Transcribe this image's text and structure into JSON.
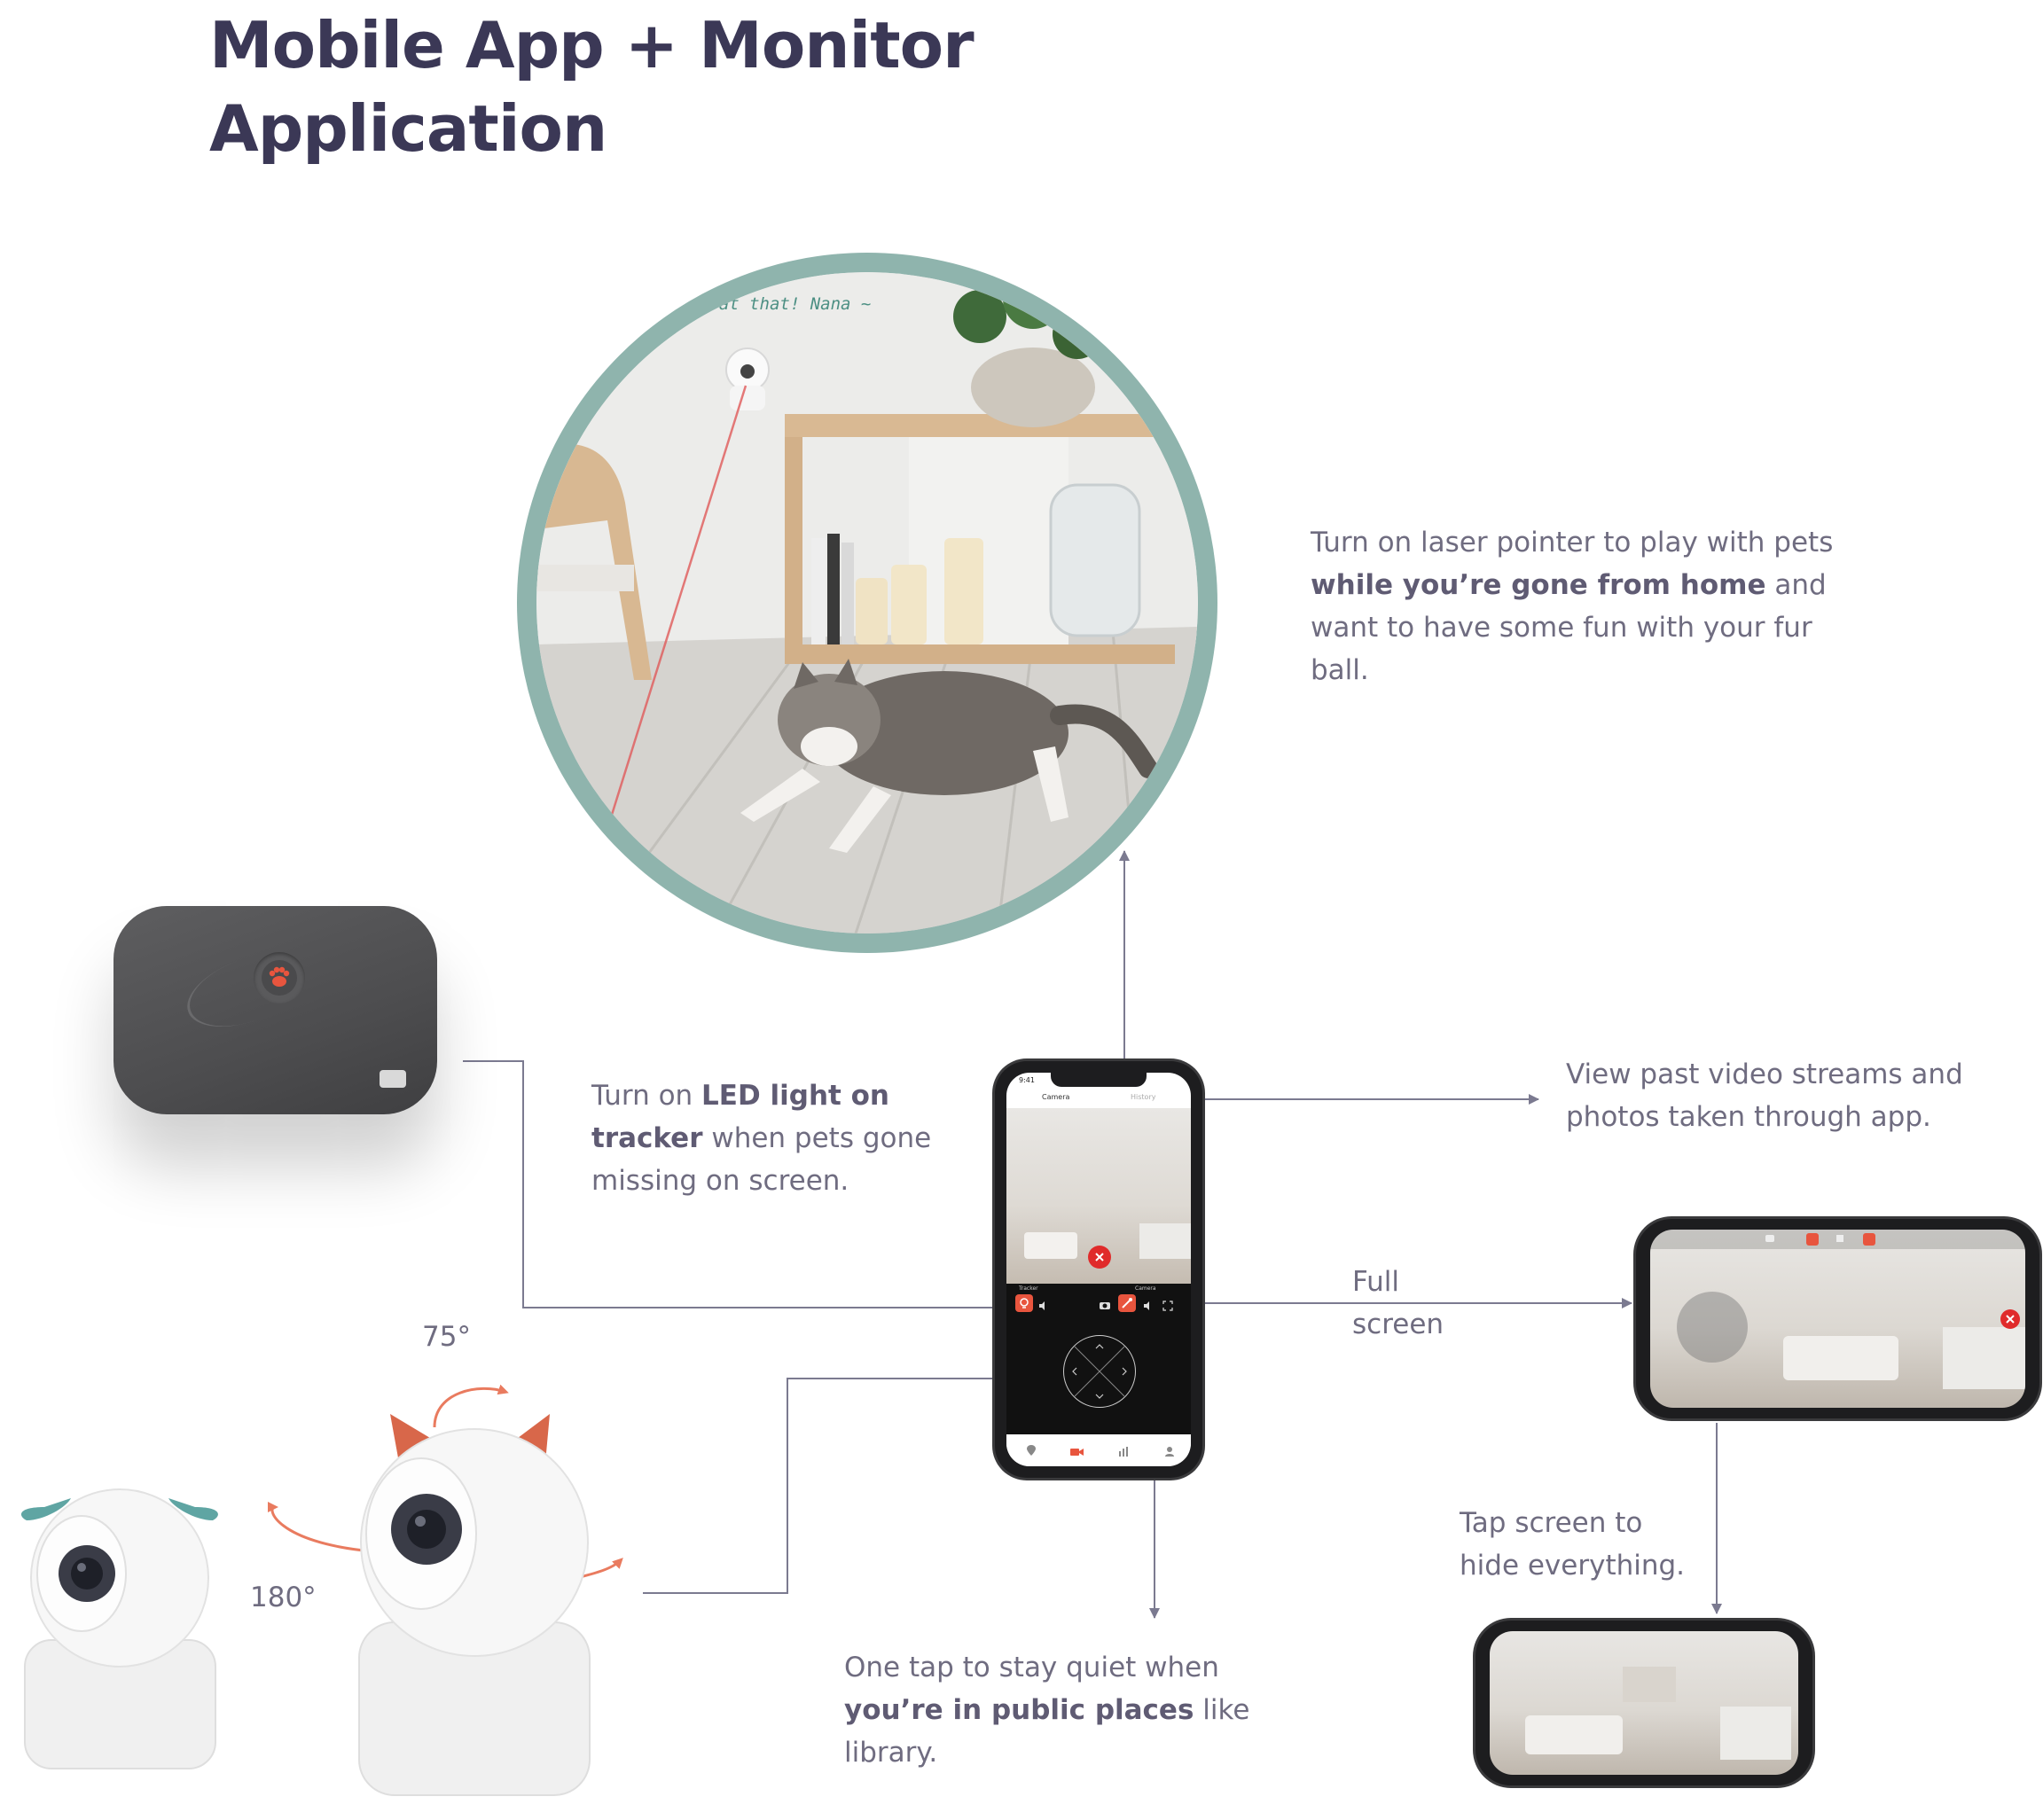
{
  "title": {
    "line1": "Mobile App + Monitor",
    "line2": "Application"
  },
  "circle_scene": {
    "caption": "ook at that! Nana ~"
  },
  "notes": {
    "laser": {
      "part1": "Turn on laser pointer to play with pets",
      "bold1": "while you’re gone from home",
      "part2": " and want to have some fun with your fur ball."
    },
    "led": {
      "part1": "Turn on ",
      "bold1": "LED light on tracker",
      "part2": " when pets gone missing on screen."
    },
    "history": {
      "text": "View past video streams and photos taken through app."
    },
    "fullscreen": {
      "line1": "Full",
      "line2": "screen"
    },
    "quiet": {
      "part1": "One tap to stay quiet when ",
      "bold1": "you’re in public places",
      "part2": " like library."
    },
    "hide": {
      "line1": "Tap screen to",
      "line2": "hide everything."
    }
  },
  "rotation": {
    "vertical": "75°",
    "horizontal": "180°"
  },
  "phone": {
    "time": "9:41",
    "tab_camera": "Camera",
    "tab_history": "History",
    "label_tracker": "Tracker",
    "label_camera": "Camera"
  },
  "colors": {
    "accent": "#e8553e",
    "heading": "#3b3856",
    "text": "#6f6c80",
    "connector": "#7b7a90",
    "circle_ring": "#8fb4ad",
    "tracker_body": "#545456",
    "ear_teal": "#5fa5a3",
    "ear_orange": "#d8674a"
  }
}
